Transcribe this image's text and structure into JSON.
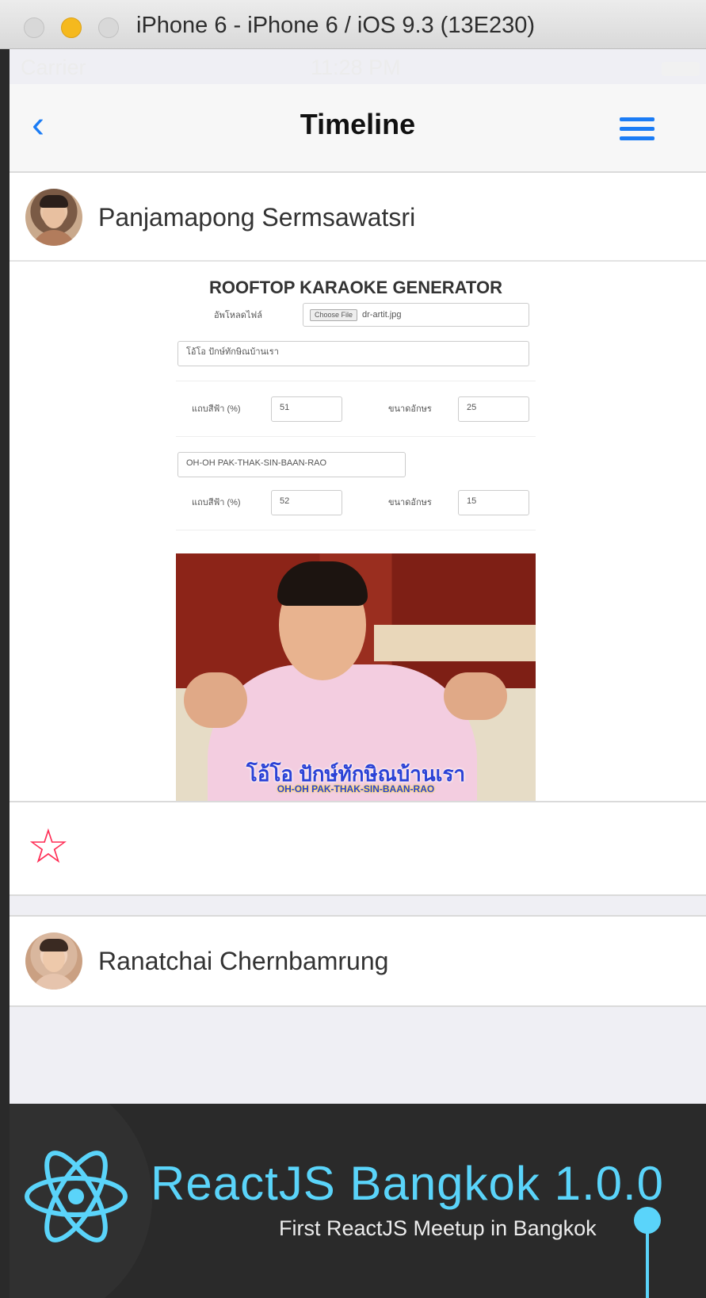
{
  "window": {
    "title": "iPhone 6 - iPhone 6 / iOS 9.3 (13E230)"
  },
  "statusbar": {
    "carrier": "Carrier",
    "time": "11:28 PM"
  },
  "navbar": {
    "back_icon": "‹",
    "title": "Timeline",
    "menu_icon": "hamburger-menu-icon"
  },
  "posts": [
    {
      "author": "Panjamapong Sermsawatsri",
      "image": {
        "form_title": "ROOFTOP KARAOKE GENERATOR",
        "upload_label": "อัพโหลดไฟล์",
        "choose_file_label": "Choose File",
        "file_name": "dr-artit.jpg",
        "thai_text_value": "โอ้โอ ปักษ์ทักษิณบ้านเรา",
        "row1_label_a": "แถบสีฟ้า (%)",
        "row1_value_a": "51",
        "row1_label_b": "ขนาดอักษร",
        "row1_value_b": "25",
        "roman_text_value": "OH-OH PAK-THAK-SIN-BAAN-RAO",
        "row2_label_a": "แถบสีฟ้า (%)",
        "row2_value_a": "52",
        "row2_label_b": "ขนาดอักษร",
        "row2_value_b": "15",
        "subtitle_thai": "โอ้โอ ปักษ์ทักษิณบ้านเรา",
        "subtitle_roman": "OH-OH PAK-THAK-SIN-BAAN-RAO"
      },
      "action_icon": "☆"
    },
    {
      "author": "Ranatchai Chernbamrung"
    }
  ],
  "banner": {
    "title": "ReactJS Bangkok 1.0.0",
    "subtitle": "First ReactJS Meetup in Bangkok"
  },
  "colors": {
    "accent": "#1b7cf5",
    "star": "#ff2d55",
    "react": "#5ad4fa"
  }
}
